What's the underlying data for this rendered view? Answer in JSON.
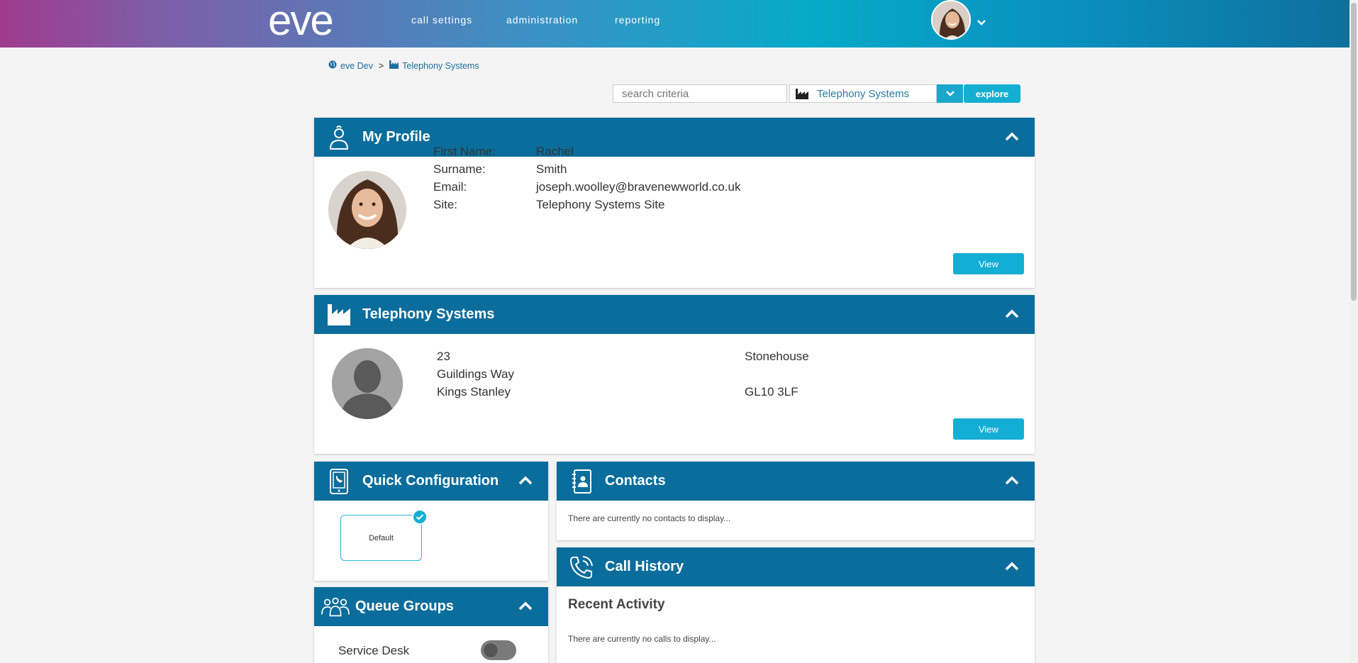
{
  "header": {
    "logo": "eve",
    "nav": [
      "call settings",
      "administration",
      "reporting"
    ]
  },
  "breadcrumb": {
    "items": [
      "eve Dev",
      "Telephony Systems"
    ],
    "separator": ">"
  },
  "search": {
    "placeholder": "search criteria",
    "selected_scope": "Telephony Systems",
    "explore_label": "explore"
  },
  "profile": {
    "title": "My Profile",
    "labels": [
      "First Name:",
      "Surname:",
      "Email:",
      "Site:"
    ],
    "values": [
      "Rachel",
      "Smith",
      "joseph.woolley@bravenewworld.co.uk",
      "Telephony Systems Site"
    ],
    "view_label": "View"
  },
  "site": {
    "title": "Telephony Systems",
    "address_left": [
      "23",
      "Guildings Way",
      "Kings Stanley"
    ],
    "address_right": [
      "Stonehouse",
      "",
      "GL10 3LF"
    ],
    "view_label": "View"
  },
  "quick_config": {
    "title": "Quick Configuration",
    "card_label": "Default"
  },
  "contacts": {
    "title": "Contacts",
    "empty": "There are currently no contacts to display..."
  },
  "call_history": {
    "title": "Call History",
    "subtitle": "Recent Activity",
    "empty": "There are currently no calls to display..."
  },
  "queue_groups": {
    "title": "Queue Groups",
    "items": [
      {
        "name": "Service Desk",
        "enabled": false
      }
    ]
  },
  "colors": {
    "panel_header": "#0b6d9c",
    "accent": "#14aed3"
  }
}
